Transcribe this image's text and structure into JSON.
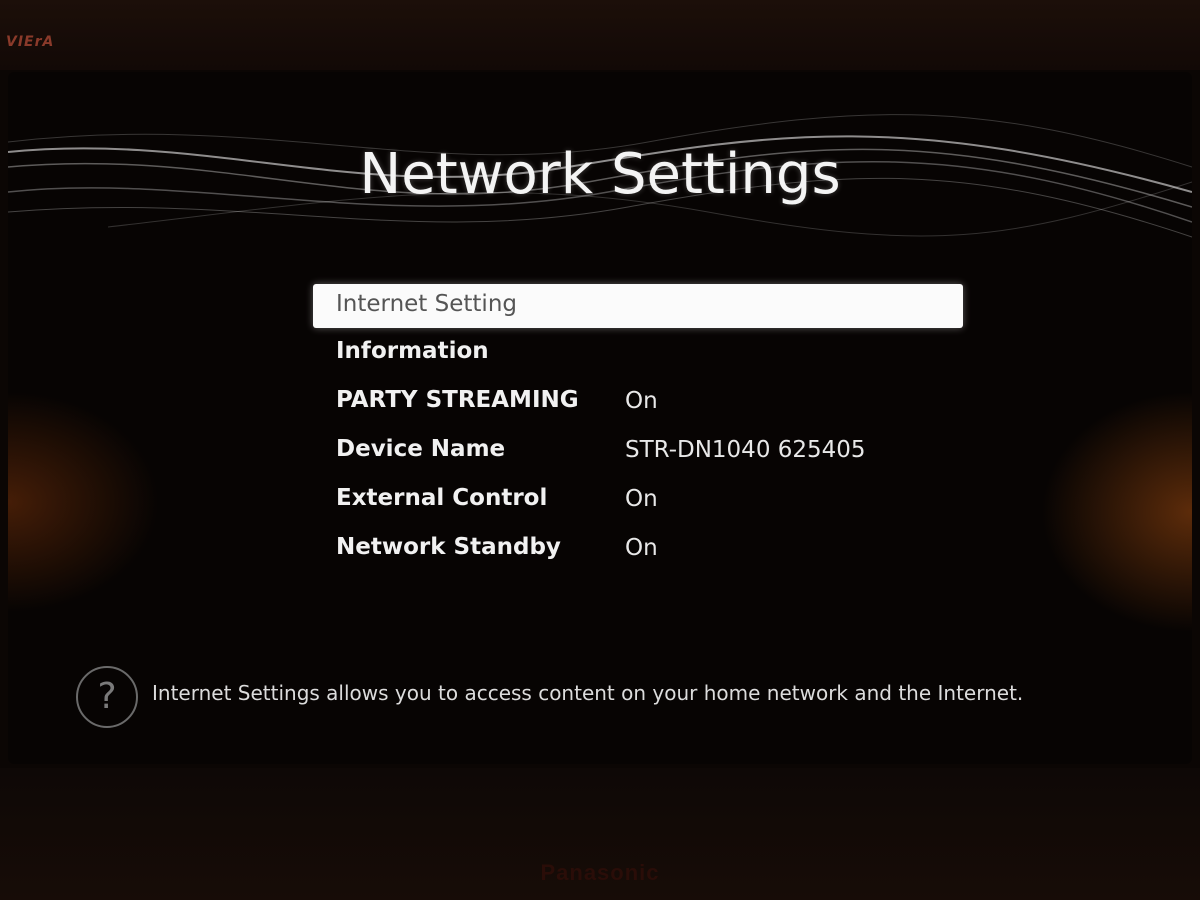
{
  "device": {
    "brand_top": "VIErA",
    "brand_bottom": "Panasonic"
  },
  "screen": {
    "title": "Network Settings",
    "menu": [
      {
        "label": "Internet Setting",
        "value": "",
        "selected": true
      },
      {
        "label": "Information",
        "value": ""
      },
      {
        "label": "PARTY STREAMING",
        "value": "On"
      },
      {
        "label": "Device Name",
        "value": "STR-DN1040 625405"
      },
      {
        "label": "External Control",
        "value": "On"
      },
      {
        "label": "Network Standby",
        "value": "On"
      }
    ],
    "help": {
      "icon": "question-icon",
      "icon_glyph": "?",
      "text": "Internet Settings allows you to access content on your home network and the Internet."
    }
  },
  "colors": {
    "background": "#070403",
    "selected_row": "#fbfbfb",
    "text": "#f1f1f1",
    "ambient_glow": "#a04a12"
  }
}
